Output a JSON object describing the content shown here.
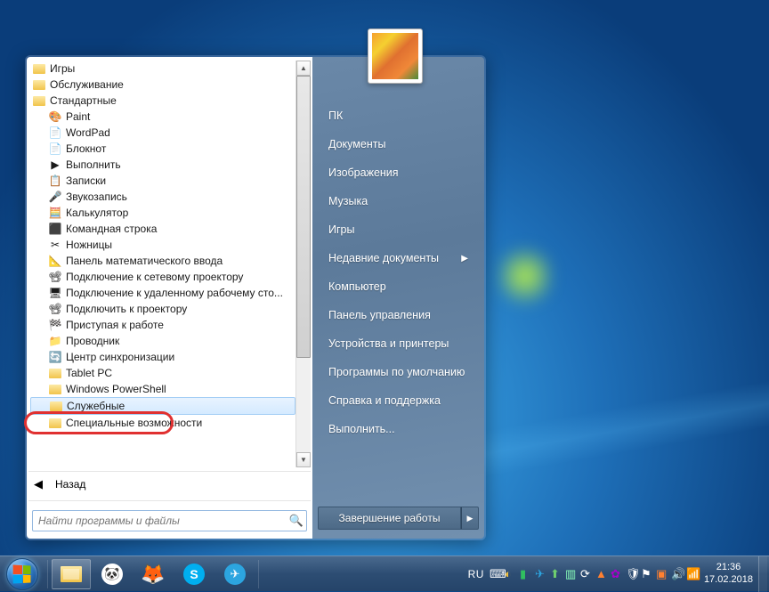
{
  "programs": {
    "folders_top": [
      "Игры",
      "Обслуживание",
      "Стандартные"
    ],
    "sub_items": [
      {
        "label": "Paint",
        "icon": "🎨"
      },
      {
        "label": "WordPad",
        "icon": "📄"
      },
      {
        "label": "Блокнот",
        "icon": "📄"
      },
      {
        "label": "Выполнить",
        "icon": "▶"
      },
      {
        "label": "Записки",
        "icon": "📋"
      },
      {
        "label": "Звукозапись",
        "icon": "🎤"
      },
      {
        "label": "Калькулятор",
        "icon": "🧮"
      },
      {
        "label": "Командная строка",
        "icon": "⬛"
      },
      {
        "label": "Ножницы",
        "icon": "✂"
      },
      {
        "label": "Панель математического ввода",
        "icon": "📐"
      },
      {
        "label": "Подключение к сетевому проектору",
        "icon": "📽"
      },
      {
        "label": "Подключение к удаленному рабочему сто...",
        "icon": "🖥"
      },
      {
        "label": "Подключить к проектору",
        "icon": "📽"
      },
      {
        "label": "Приступая к работе",
        "icon": "🏁"
      },
      {
        "label": "Проводник",
        "icon": "📁"
      },
      {
        "label": "Центр синхронизации",
        "icon": "🔄"
      }
    ],
    "sub_folders": [
      "Tablet PC",
      "Windows PowerShell",
      "Служебные",
      "Специальные возможности"
    ],
    "selected_index": 2,
    "back_label": "Назад"
  },
  "search": {
    "placeholder": "Найти программы и файлы"
  },
  "right": {
    "items": [
      {
        "label": "ПК"
      },
      {
        "label": "Документы"
      },
      {
        "label": "Изображения"
      },
      {
        "label": "Музыка"
      },
      {
        "label": "Игры"
      },
      {
        "label": "Недавние документы",
        "submenu": true
      },
      {
        "label": "Компьютер"
      },
      {
        "label": "Панель управления"
      },
      {
        "label": "Устройства и принтеры"
      },
      {
        "label": "Программы по умолчанию"
      },
      {
        "label": "Справка и поддержка"
      },
      {
        "label": "Выполнить..."
      }
    ],
    "shutdown": "Завершение работы"
  },
  "taskbar": {
    "lang": "RU",
    "time": "21:36",
    "date": "17.02.2018"
  }
}
